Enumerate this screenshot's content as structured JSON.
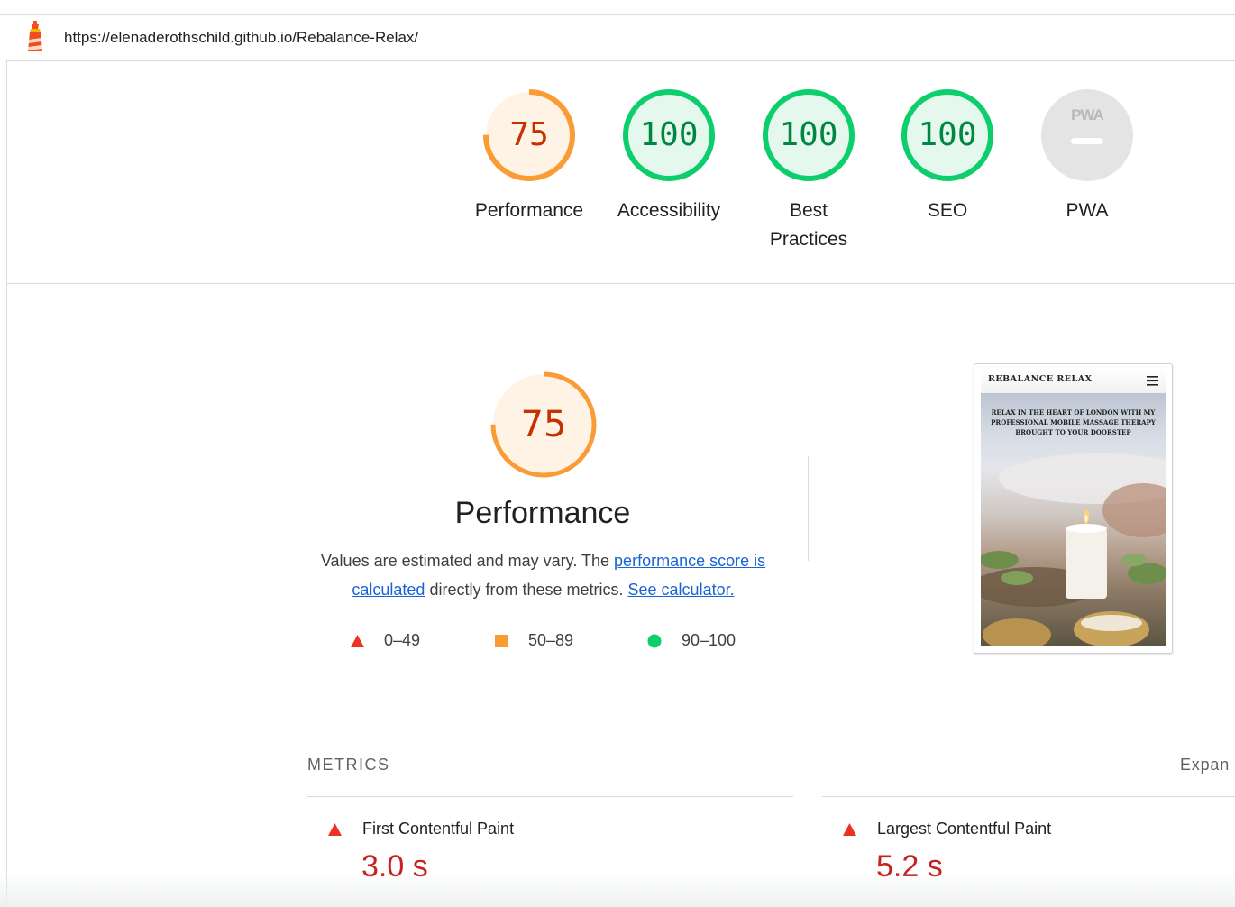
{
  "browser": {
    "url": "https://elenaderothschild.github.io/Rebalance-Relax/"
  },
  "gauges": [
    {
      "label": "Performance",
      "score": "75",
      "value": 0.75,
      "status": "average"
    },
    {
      "label": "Accessibility",
      "score": "100",
      "value": 1.0,
      "status": "pass"
    },
    {
      "label_lines": [
        "Best",
        "Practices"
      ],
      "score": "100",
      "value": 1.0,
      "status": "pass"
    },
    {
      "label": "SEO",
      "score": "100",
      "value": 1.0,
      "status": "pass"
    },
    {
      "label": "PWA",
      "badge": "PWA",
      "status": "na"
    }
  ],
  "performance": {
    "score": "75",
    "value": 0.75,
    "title": "Performance",
    "desc_prefix": "Values are estimated and may vary. The ",
    "link1": "performance score is calculated",
    "desc_middle": " directly from these metrics. ",
    "link2": "See calculator."
  },
  "legend": [
    {
      "icon": "red-triangle-icon",
      "range": "0–49"
    },
    {
      "icon": "orange-square-icon",
      "range": "50–89"
    },
    {
      "icon": "green-circle-icon",
      "range": "90–100"
    }
  ],
  "thumbnail": {
    "brand": "REBALANCE RELAX",
    "tagline": "RELAX IN THE HEART OF LONDON WITH MY PROFESSIONAL MOBILE MASSAGE THERAPY BROUGHT TO YOUR DOORSTEP"
  },
  "metrics": {
    "heading": "METRICS",
    "expand": "Expan",
    "items": [
      {
        "name": "First Contentful Paint",
        "value": "3.0 s",
        "status": "fail"
      },
      {
        "name": "Largest Contentful Paint",
        "value": "5.2 s",
        "status": "fail"
      }
    ]
  },
  "colors": {
    "fail": "#c5221f",
    "average": "#fa9c35",
    "average_text": "#c33300",
    "pass": "#0cce6b",
    "pass_text": "#018642",
    "link": "#1a62d6"
  }
}
